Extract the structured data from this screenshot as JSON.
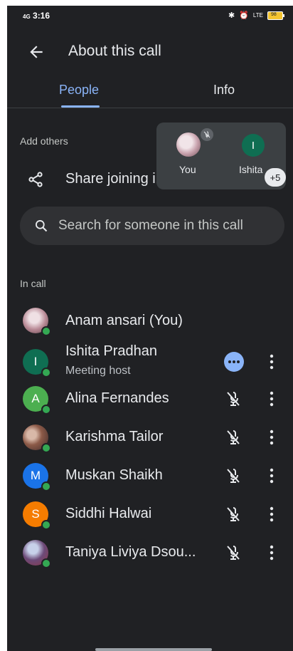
{
  "status_bar": {
    "time": "3:16",
    "signal": "4G",
    "network": "LTE",
    "battery": "98"
  },
  "app_bar": {
    "title": "About this call"
  },
  "tabs": [
    {
      "label": "People"
    },
    {
      "label": "Info"
    }
  ],
  "sections": {
    "add_others": "Add others",
    "in_call": "In call"
  },
  "share": {
    "label": "Share joining info"
  },
  "tiles": {
    "you_label": "You",
    "ishita_label": "Ishita",
    "ishita_initial": "I",
    "more_count": "+5"
  },
  "search": {
    "placeholder": "Search for someone in this call"
  },
  "participants": [
    {
      "name": "Anam ansari (You)",
      "initial": ""
    },
    {
      "name": "Ishita Pradhan",
      "initial": "I",
      "subtitle": "Meeting host"
    },
    {
      "name": "Alina Fernandes",
      "initial": "A"
    },
    {
      "name": "Karishma Tailor",
      "initial": ""
    },
    {
      "name": "Muskan Shaikh",
      "initial": "M"
    },
    {
      "name": "Siddhi Halwai",
      "initial": "S"
    },
    {
      "name": "Taniya Liviya Dsou...",
      "initial": ""
    }
  ],
  "colors": {
    "background": "#202124",
    "accent": "#8ab4f8",
    "online": "#34a853",
    "ishita_avatar": "#0f6e52",
    "alina_avatar": "#4caf50",
    "muskan_avatar": "#1a73e8",
    "siddhi_avatar": "#f57c00"
  }
}
